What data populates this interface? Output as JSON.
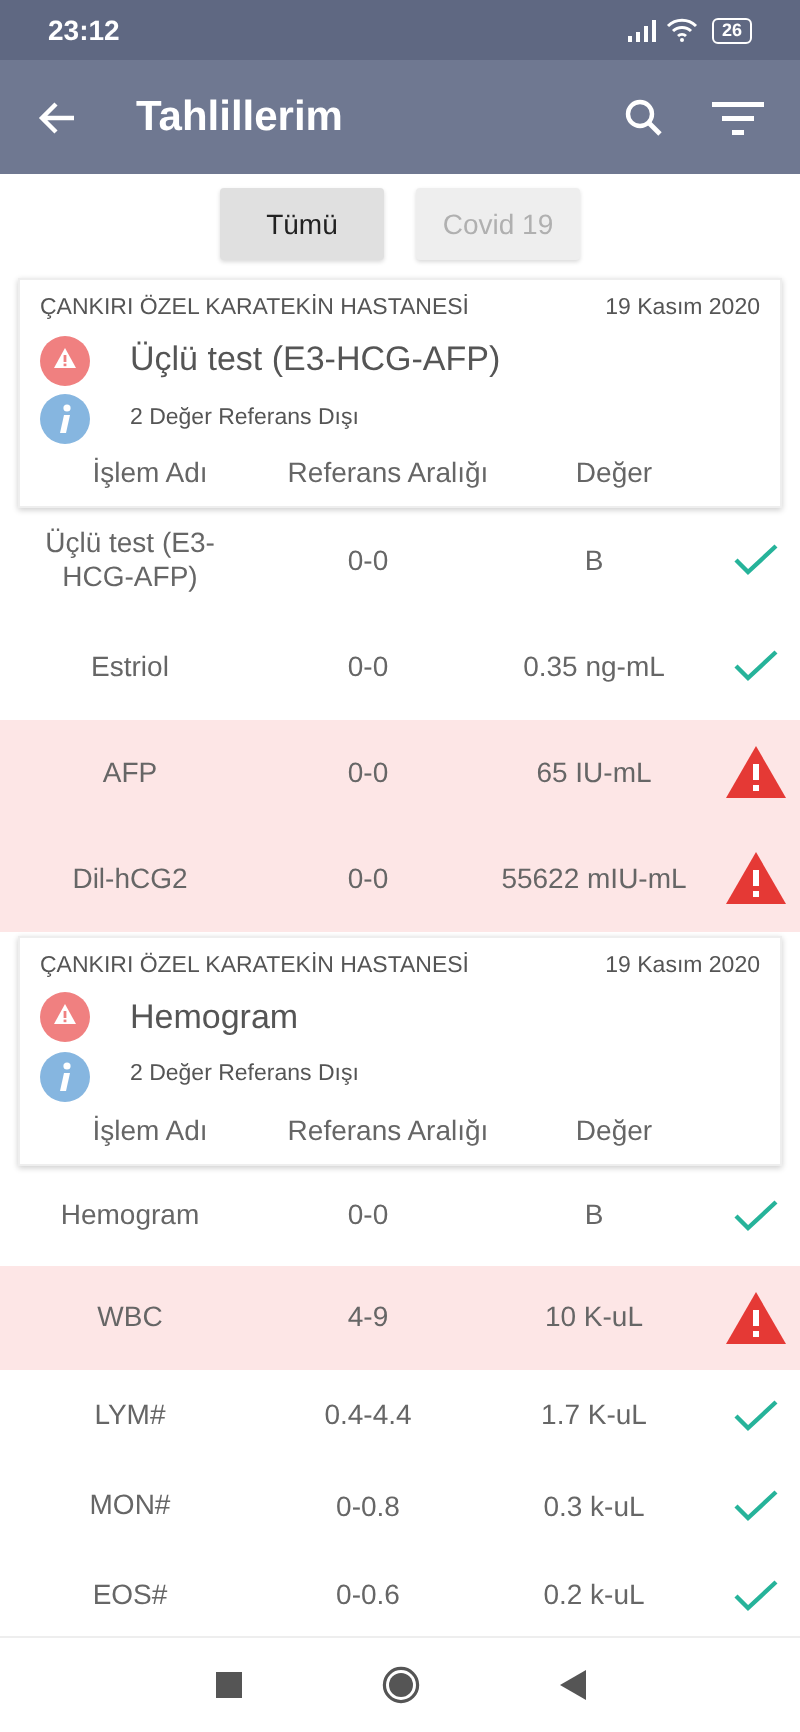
{
  "status_bar": {
    "time": "23:12",
    "battery": "26"
  },
  "app_bar": {
    "title": "Tahlillerim"
  },
  "filters": [
    {
      "label": "Tümü",
      "selected": true
    },
    {
      "label": "Covid 19",
      "selected": false
    }
  ],
  "results": [
    {
      "hospital": "ÇANKIRI ÖZEL KARATEKİN HASTANESİ",
      "date": "19 Kasım 2020",
      "test_name": "Üçlü test (E3-HCG-AFP)",
      "summary": "2 Değer Referans Dışı",
      "columns": [
        "İşlem Adı",
        "Referans Aralığı",
        "Değer"
      ],
      "rows": [
        {
          "name": "Üçlü test (E3-HCG-AFP)",
          "range": "0-0",
          "value": "B",
          "abnormal": false
        },
        {
          "name": "Estriol",
          "range": "0-0",
          "value": "0.35 ng-mL",
          "abnormal": false
        },
        {
          "name": "AFP",
          "range": "0-0",
          "value": "65 IU-mL",
          "abnormal": true
        },
        {
          "name": "Dil-hCG2",
          "range": "0-0",
          "value": "55622 mIU-mL",
          "abnormal": true
        }
      ]
    },
    {
      "hospital": "ÇANKIRI ÖZEL KARATEKİN HASTANESİ",
      "date": "19 Kasım 2020",
      "test_name": "Hemogram",
      "summary": "2 Değer Referans Dışı",
      "columns": [
        "İşlem Adı",
        "Referans Aralığı",
        "Değer"
      ],
      "rows": [
        {
          "name": "Hemogram",
          "range": "0-0",
          "value": "B",
          "abnormal": false
        },
        {
          "name": "WBC",
          "range": "4-9",
          "value": "10 K-uL",
          "abnormal": true
        },
        {
          "name": "LYM#",
          "range": "0.4-4.4",
          "value": "1.7 K-uL",
          "abnormal": false
        },
        {
          "name": "MON#",
          "range": "0-0.8",
          "value": "0.3 k-uL",
          "abnormal": false
        },
        {
          "name": "EOS#",
          "range": "0-0.6",
          "value": "0.2 k-uL",
          "abnormal": false
        }
      ]
    }
  ]
}
